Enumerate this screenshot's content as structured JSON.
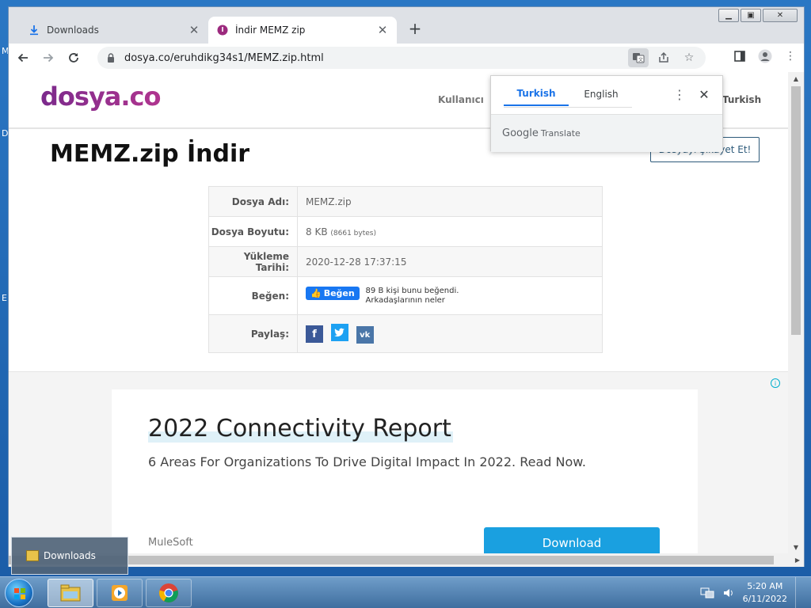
{
  "browser": {
    "tabs": [
      {
        "title": "Downloads",
        "active": false
      },
      {
        "title": "İndir MEMZ zip",
        "active": true
      }
    ],
    "url": "dosya.co/eruhdikg34s1/MEMZ.zip.html"
  },
  "site": {
    "logo": "dosya.co",
    "nav_user": "Kullanıcı",
    "nav_lang": "Turkish",
    "title": "MEMZ.zip İndir",
    "complain_label": "Dosyayı Şikayet Et!",
    "file": {
      "name_label": "Dosya Adı:",
      "name": "MEMZ.zip",
      "size_label": "Dosya Boyutu:",
      "size": "8 KB",
      "size_bytes": "(8661 bytes)",
      "date_label": "Yükleme Tarihi:",
      "date": "2020-12-28 17:37:15",
      "like_label": "Beğen:",
      "like_button": "Beğen",
      "like_text_1": "89 B kişi bunu beğendi.",
      "like_text_2": "Arkadaşlarının neler",
      "share_label": "Paylaş:"
    }
  },
  "ad": {
    "title": "2022 Connectivity Report",
    "subtitle": "6 Areas For Organizations To Drive Digital Impact In 2022. Read Now.",
    "brand": "MuleSoft",
    "button": "Download"
  },
  "translate_popup": {
    "tab_source": "Turkish",
    "tab_target": "English",
    "footer_google": "Google",
    "footer_translate": "Translate"
  },
  "downloads_flyout": {
    "label": "Downloads"
  },
  "taskbar": {
    "time": "5:20 AM",
    "date": "6/11/2022"
  },
  "colors": {
    "accent": "#1a73e8",
    "logo": "#8b2f8f",
    "ad_button": "#1aa0e0",
    "facebook": "#3b5998",
    "twitter": "#1da1f2",
    "vk": "#4a76a8"
  }
}
